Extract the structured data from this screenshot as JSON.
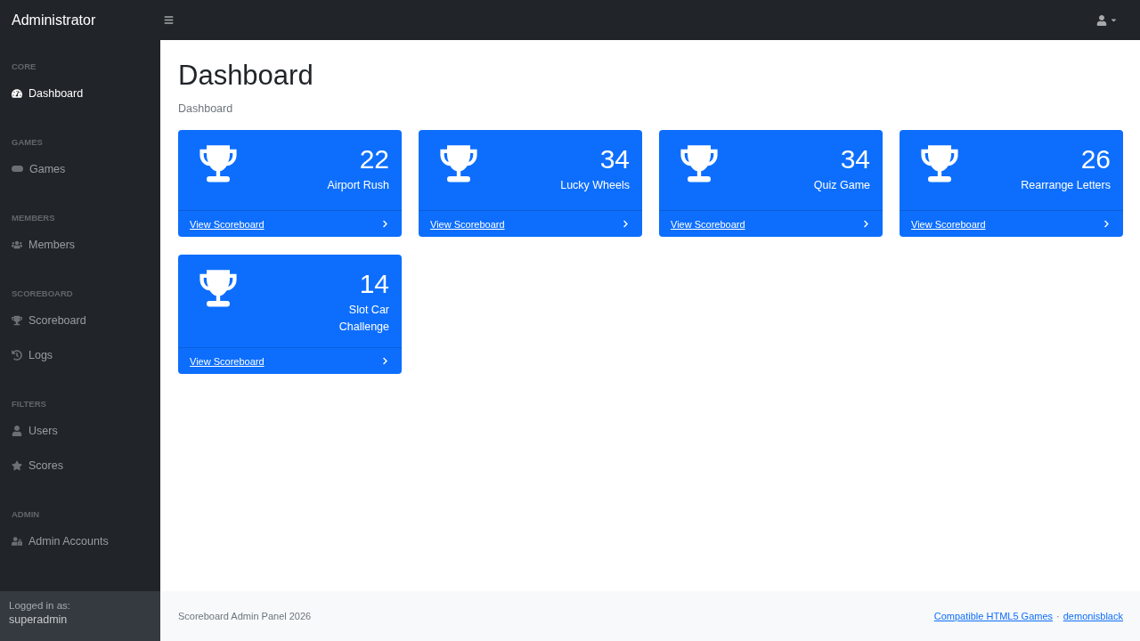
{
  "brand": "Administrator",
  "sidebar": {
    "sections": [
      {
        "heading": "CORE",
        "items": [
          {
            "label": "Dashboard",
            "selected": true
          }
        ]
      },
      {
        "heading": "GAMES",
        "items": [
          {
            "label": "Games",
            "selected": false
          }
        ]
      },
      {
        "heading": "MEMBERS",
        "items": [
          {
            "label": "Members",
            "selected": false
          }
        ]
      },
      {
        "heading": "SCOREBOARD",
        "items": [
          {
            "label": "Scoreboard",
            "selected": false
          },
          {
            "label": "Logs",
            "selected": false
          }
        ]
      },
      {
        "heading": "FILTERS",
        "items": [
          {
            "label": "Users",
            "selected": false
          },
          {
            "label": "Scores",
            "selected": false
          }
        ]
      },
      {
        "heading": "ADMIN",
        "items": [
          {
            "label": "Admin Accounts",
            "selected": false
          }
        ]
      }
    ],
    "footer": {
      "label": "Logged in as:",
      "user": "superadmin"
    }
  },
  "page": {
    "title": "Dashboard",
    "breadcrumb": "Dashboard"
  },
  "cards": [
    {
      "count": "22",
      "name": "Airport Rush",
      "link": "View Scoreboard"
    },
    {
      "count": "34",
      "name": "Lucky Wheels",
      "link": "View Scoreboard"
    },
    {
      "count": "34",
      "name": "Quiz Game",
      "link": "View Scoreboard"
    },
    {
      "count": "26",
      "name": "Rearrange Letters",
      "link": "View Scoreboard"
    },
    {
      "count": "14",
      "name": "Slot Car Challenge",
      "link": "View Scoreboard"
    }
  ],
  "footer": {
    "copyright": "Scoreboard Admin Panel 2026",
    "links": [
      "Compatible HTML5 Games",
      "demonisblack"
    ],
    "separator": "·"
  }
}
